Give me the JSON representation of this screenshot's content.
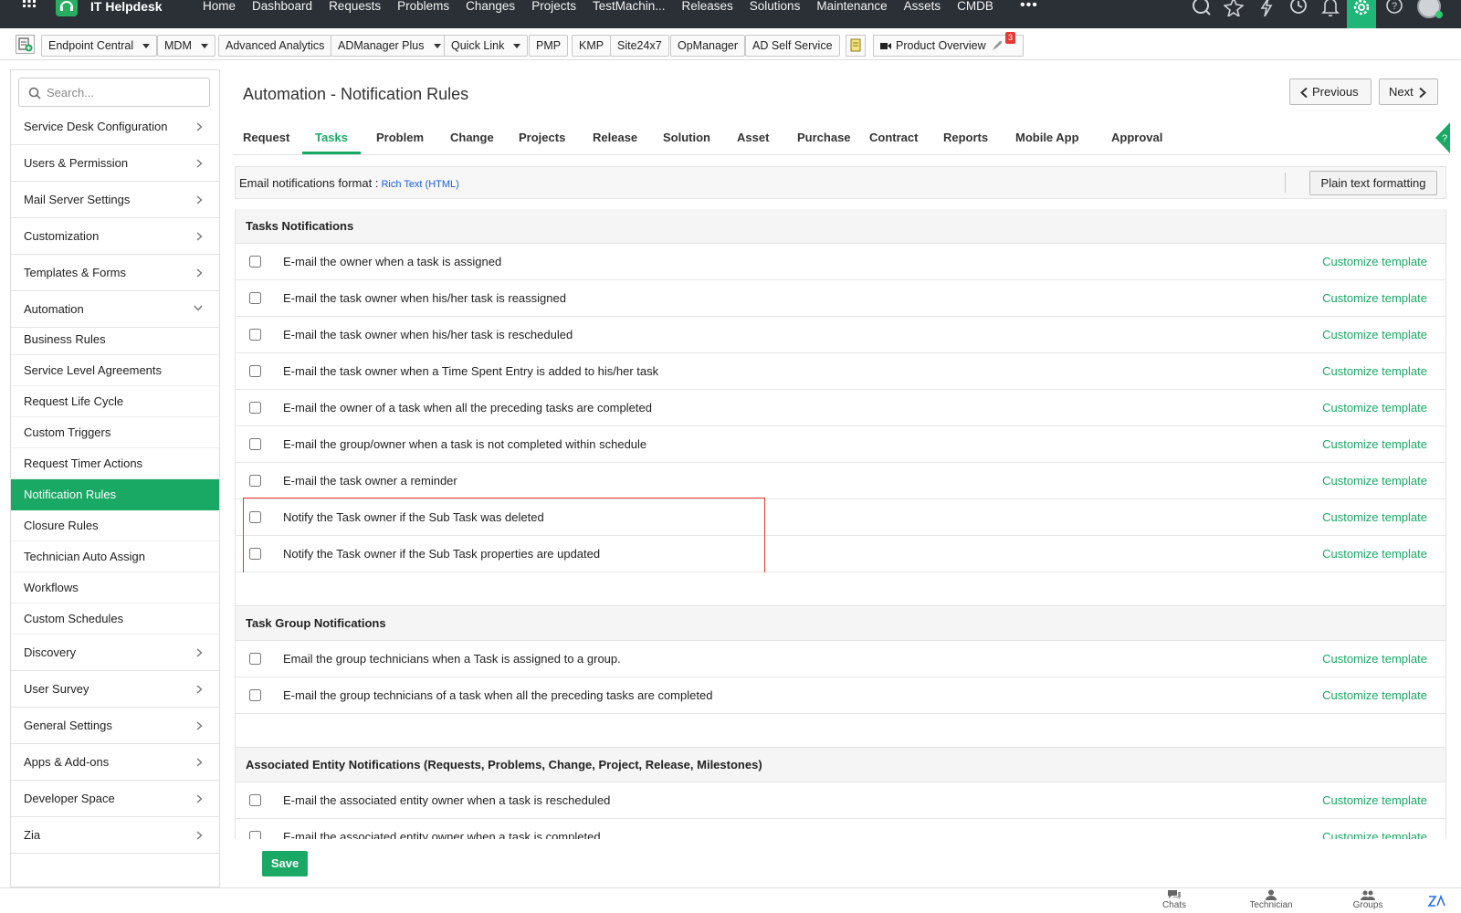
{
  "app": {
    "title": "IT Helpdesk"
  },
  "topnav": {
    "items": [
      "Home",
      "Dashboard",
      "Requests",
      "Problems",
      "Changes",
      "Projects",
      "TestMachin...",
      "Releases",
      "Solutions",
      "Maintenance",
      "Assets",
      "CMDB"
    ],
    "more": "•••"
  },
  "quicklinks": {
    "items": [
      {
        "label": "Endpoint Central",
        "dropdown": true
      },
      {
        "label": "MDM",
        "dropdown": true
      },
      {
        "label": "Advanced Analytics",
        "dropdown": false
      },
      {
        "label": "ADManager Plus",
        "dropdown": true
      },
      {
        "label": "Quick Link",
        "dropdown": true
      },
      {
        "label": "PMP",
        "dropdown": false
      },
      {
        "label": "KMP",
        "dropdown": false
      },
      {
        "label": "Site24x7",
        "dropdown": false
      },
      {
        "label": "OpManager",
        "dropdown": false
      },
      {
        "label": "AD Self Service",
        "dropdown": false
      }
    ],
    "product_overview": "Product Overview",
    "badge_count": "3"
  },
  "sidebar": {
    "search_placeholder": "Search...",
    "categories_top": [
      "Service Desk Configuration",
      "Users & Permission",
      "Mail Server Settings",
      "Customization",
      "Templates & Forms",
      "Automation"
    ],
    "automation_items": [
      "Business Rules",
      "Service Level Agreements",
      "Request Life Cycle",
      "Custom Triggers",
      "Request Timer Actions",
      "Notification Rules",
      "Closure Rules",
      "Technician Auto Assign",
      "Workflows",
      "Custom Schedules"
    ],
    "active_item": "Notification Rules",
    "categories_bottom": [
      "Discovery",
      "User Survey",
      "General Settings",
      "Apps & Add-ons",
      "Developer Space",
      "Zia"
    ]
  },
  "main": {
    "title": "Automation - Notification Rules",
    "prev_label": "Previous",
    "next_label": "Next",
    "tabs": [
      "Request",
      "Tasks",
      "Problem",
      "Change",
      "Projects",
      "Release",
      "Solution",
      "Asset",
      "Purchase",
      "Contract",
      "Reports",
      "Mobile App",
      "Approval"
    ],
    "active_tab": "Tasks",
    "format_label": "Email notifications format :",
    "format_value": "Rich Text (HTML)",
    "plain_text_button": "Plain text formatting",
    "customize_label": "Customize template",
    "save_label": "Save",
    "sections": [
      {
        "title": "Tasks Notifications",
        "rows": [
          "E-mail the owner when a task is assigned",
          "E-mail the task owner when his/her task is reassigned",
          "E-mail the task owner when his/her task is rescheduled",
          "E-mail the task owner when a Time Spent Entry is added to his/her task",
          "E-mail the owner of a task when all the preceding tasks are completed",
          "E-mail the group/owner when a task is not completed within schedule",
          "E-mail the task owner a reminder",
          "Notify the Task owner if the Sub Task was deleted",
          "Notify the Task owner if the Sub Task properties are updated"
        ]
      },
      {
        "title": "Task Group Notifications",
        "rows": [
          "Email the group technicians when a Task is assigned to a group.",
          "E-mail the group technicians of a task when all the preceding tasks are completed"
        ]
      },
      {
        "title": "Associated Entity Notifications (Requests, Problems, Change, Project, Release, Milestones)",
        "rows": [
          "E-mail the associated entity owner when a task is rescheduled",
          "E-mail the associated entity owner when a task is completed"
        ]
      }
    ]
  },
  "bottombar": {
    "items": [
      "Chats",
      "Technician",
      "Groups"
    ]
  },
  "colors": {
    "accent": "#1aa865",
    "topbar": "#2b3036",
    "highlight": "#e53935",
    "link": "#1a5de6"
  }
}
